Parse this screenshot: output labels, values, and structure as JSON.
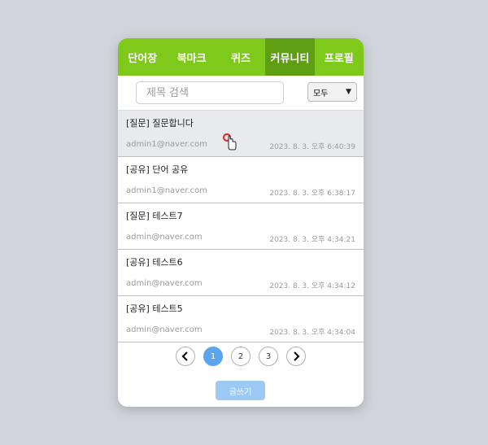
{
  "nav": {
    "tabs": [
      {
        "label": "단어장",
        "active": false
      },
      {
        "label": "북마크",
        "active": false
      },
      {
        "label": "퀴즈",
        "active": false
      },
      {
        "label": "커뮤니티",
        "active": true
      },
      {
        "label": "프로필",
        "active": false
      }
    ]
  },
  "search": {
    "placeholder": "제목 검색",
    "value": ""
  },
  "filter": {
    "selected": "모두",
    "chevron_icon": "chevron-down-icon"
  },
  "posts": [
    {
      "title": "[질문] 질문합니다",
      "author": "admin1@naver.com",
      "date": "2023. 8. 3. 오후 6:40:39",
      "hovered": true
    },
    {
      "title": "[공유] 단어 공유",
      "author": "admin1@naver.com",
      "date": "2023. 8. 3. 오후 6:38:17",
      "hovered": false
    },
    {
      "title": "[질문] 테스트7",
      "author": "admin@naver.com",
      "date": "2023. 8. 3. 오후 4:34:21",
      "hovered": false
    },
    {
      "title": "[공유] 테스트6",
      "author": "admin@naver.com",
      "date": "2023. 8. 3. 오후 4:34:12",
      "hovered": false
    },
    {
      "title": "[공유] 테스트5",
      "author": "admin@naver.com",
      "date": "2023. 8. 3. 오후 4:34:04",
      "hovered": false
    }
  ],
  "pagination": {
    "prev_icon": "chevron-left-icon",
    "next_icon": "chevron-right-icon",
    "pages": [
      "1",
      "2",
      "3"
    ],
    "current": "1"
  },
  "write_button": {
    "label": "글쓰기"
  },
  "colors": {
    "nav_bg": "#7ec919",
    "nav_active": "#5d9e12",
    "page_active": "#5aa5ee",
    "write_btn": "#9ccaf4"
  }
}
